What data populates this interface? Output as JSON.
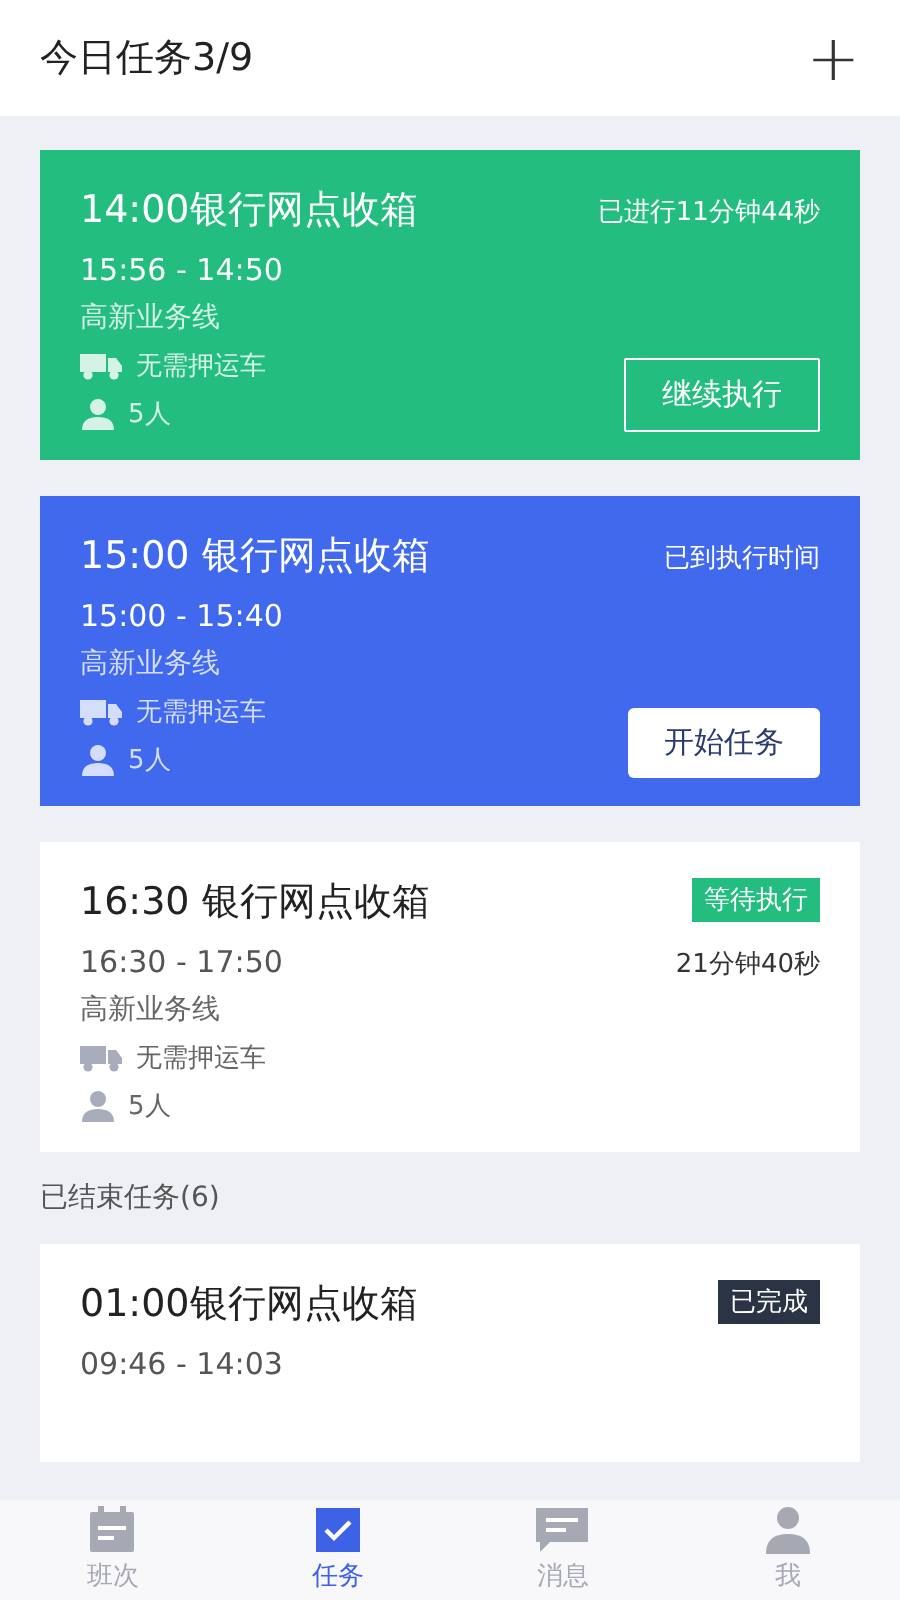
{
  "header": {
    "title": "今日任务3/9",
    "add_button": "+"
  },
  "active_tasks": [
    {
      "kind": "in_progress",
      "title": "14:00银行网点收箱",
      "status": "已进行11分钟44秒",
      "time": "15:56 - 14:50",
      "route": "高新业务线",
      "escort": "无需押运车",
      "staff": "5人",
      "action": "继续执行"
    },
    {
      "kind": "due",
      "title": "15:00 银行网点收箱",
      "status": "已到执行时间",
      "time": "15:00 - 15:40",
      "route": "高新业务线",
      "escort": "无需押运车",
      "staff": "5人",
      "action": "开始任务"
    },
    {
      "kind": "waiting",
      "title": "16:30 银行网点收箱",
      "badge": "等待执行",
      "countdown": "21分钟40秒",
      "time": "16:30 - 17:50",
      "route": "高新业务线",
      "escort": "无需押运车",
      "staff": "5人"
    }
  ],
  "finished_section": {
    "title": "已结束任务(6)"
  },
  "finished_tasks": [
    {
      "kind": "done",
      "title": "01:00银行网点收箱",
      "badge": "已完成",
      "time": "09:46 - 14:03"
    }
  ],
  "tab_bar": [
    {
      "kind": "calendar",
      "label": "班次",
      "selected": false
    },
    {
      "kind": "check",
      "label": "任务",
      "selected": true
    },
    {
      "kind": "message",
      "label": "消息",
      "selected": false
    },
    {
      "kind": "person",
      "label": "我",
      "selected": false
    }
  ]
}
